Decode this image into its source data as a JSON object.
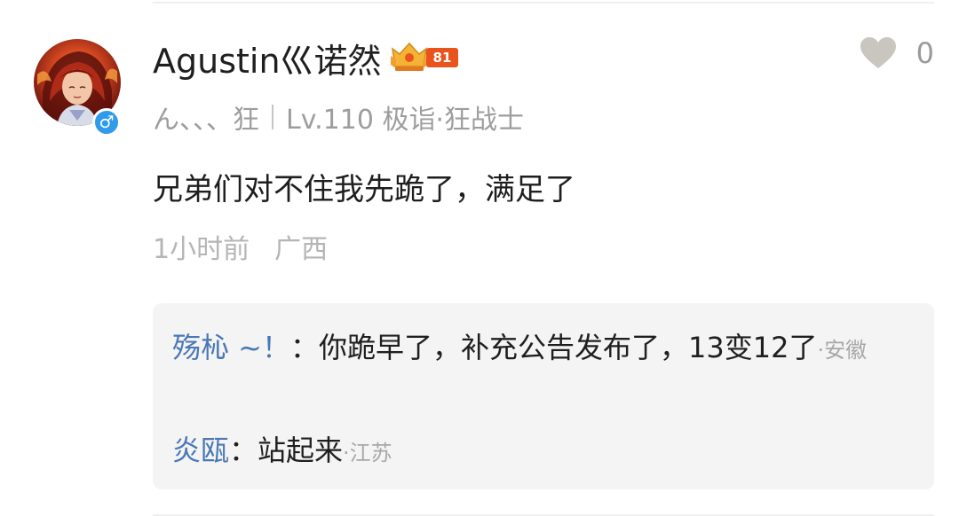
{
  "comment": {
    "username": "Agustin巛诺然",
    "rank_badge_level": "81",
    "gender_symbol": "♂",
    "like_count": "0",
    "meta": {
      "signature": "ん、、、狂",
      "level": "Lv.110 极诣·狂战士"
    },
    "text": "兄弟们对不住我先跪了，满足了",
    "time": "1小时前",
    "location": "广西"
  },
  "replies": [
    {
      "user": "殇杺 ~！",
      "separator": "：",
      "text": "你跪早了，补充公告发布了，13变12了",
      "location": "·安徽"
    },
    {
      "user": "炎瓯",
      "separator": "：",
      "text": "站起来",
      "location": "·江苏"
    }
  ],
  "colors": {
    "reply_user": "#4a78b5",
    "gender_badge": "#2f9bea",
    "rank_level_bg": "#e8541c",
    "muted_text": "#9d9d9d"
  },
  "icons": {
    "like": "heart-icon",
    "gender": "male-icon",
    "rank": "crown-badge-icon"
  }
}
